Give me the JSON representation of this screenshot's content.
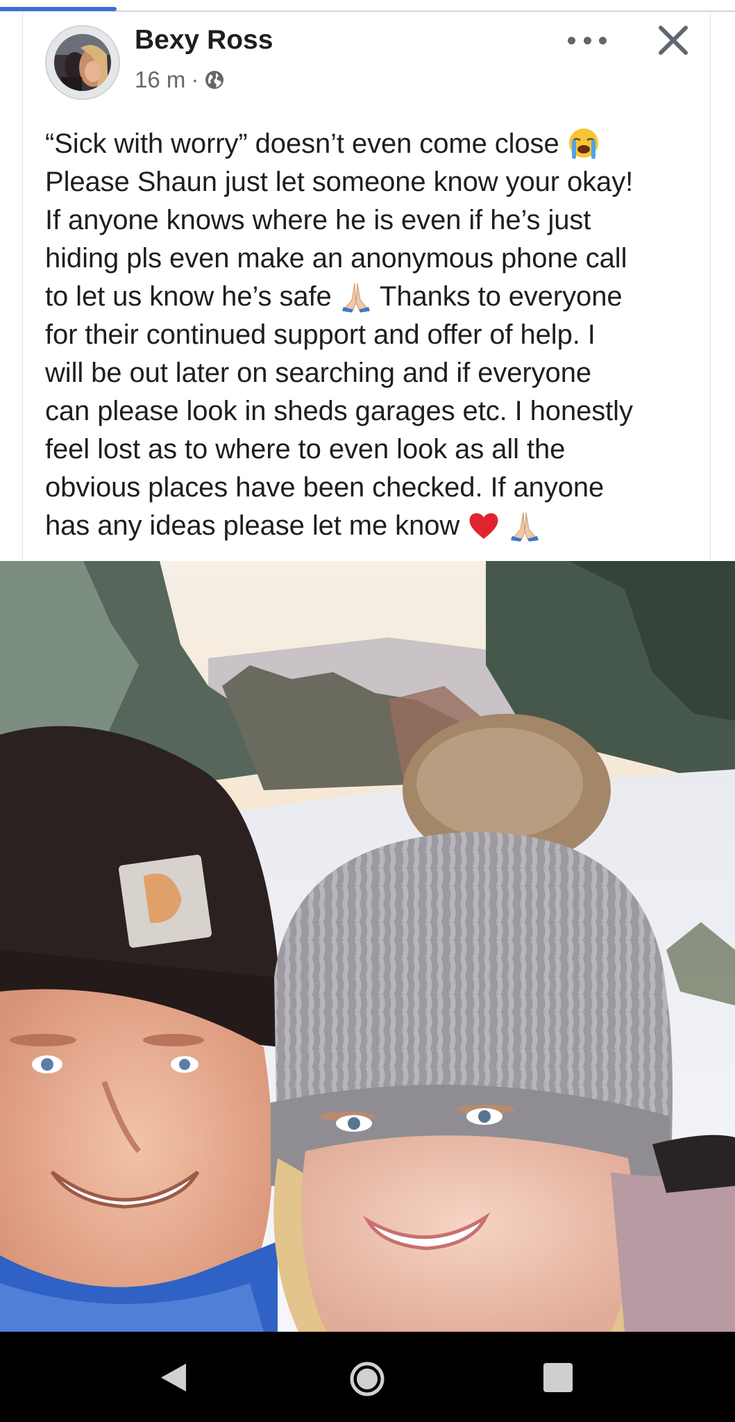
{
  "post": {
    "author": "Bexy Ross",
    "time": "16 m",
    "separator": "·",
    "privacy_icon": "globe-icon",
    "text_lines": [
      "“Sick with worry” doesn’t even come close",
      "Please Shaun just let someone know your okay!",
      "If anyone knows where he is even if he’s just",
      "hiding pls even make an anonymous phone call",
      "to let us know he’s safe",
      "Thanks to everyone",
      "for their continued support and offer of help. I",
      "will be out later on searching and if everyone",
      "can please look in sheds garages etc. I honestly",
      "feel lost as to where to even look as all the",
      "obvious places have been checked. If anyone",
      "has any ideas please let me know"
    ],
    "emojis": [
      "loudly-crying-face",
      "folded-hands",
      "red-heart"
    ]
  },
  "header": {
    "more_icon": "more-options-icon",
    "close_icon": "close-icon"
  },
  "navbar": {
    "back_icon": "back-triangle-icon",
    "home_icon": "home-circle-icon",
    "recents_icon": "recents-square-icon"
  },
  "colors": {
    "text": "#1c1e21",
    "secondary": "#65676b",
    "accent": "#3b6fd8",
    "navbar": "#000000"
  }
}
